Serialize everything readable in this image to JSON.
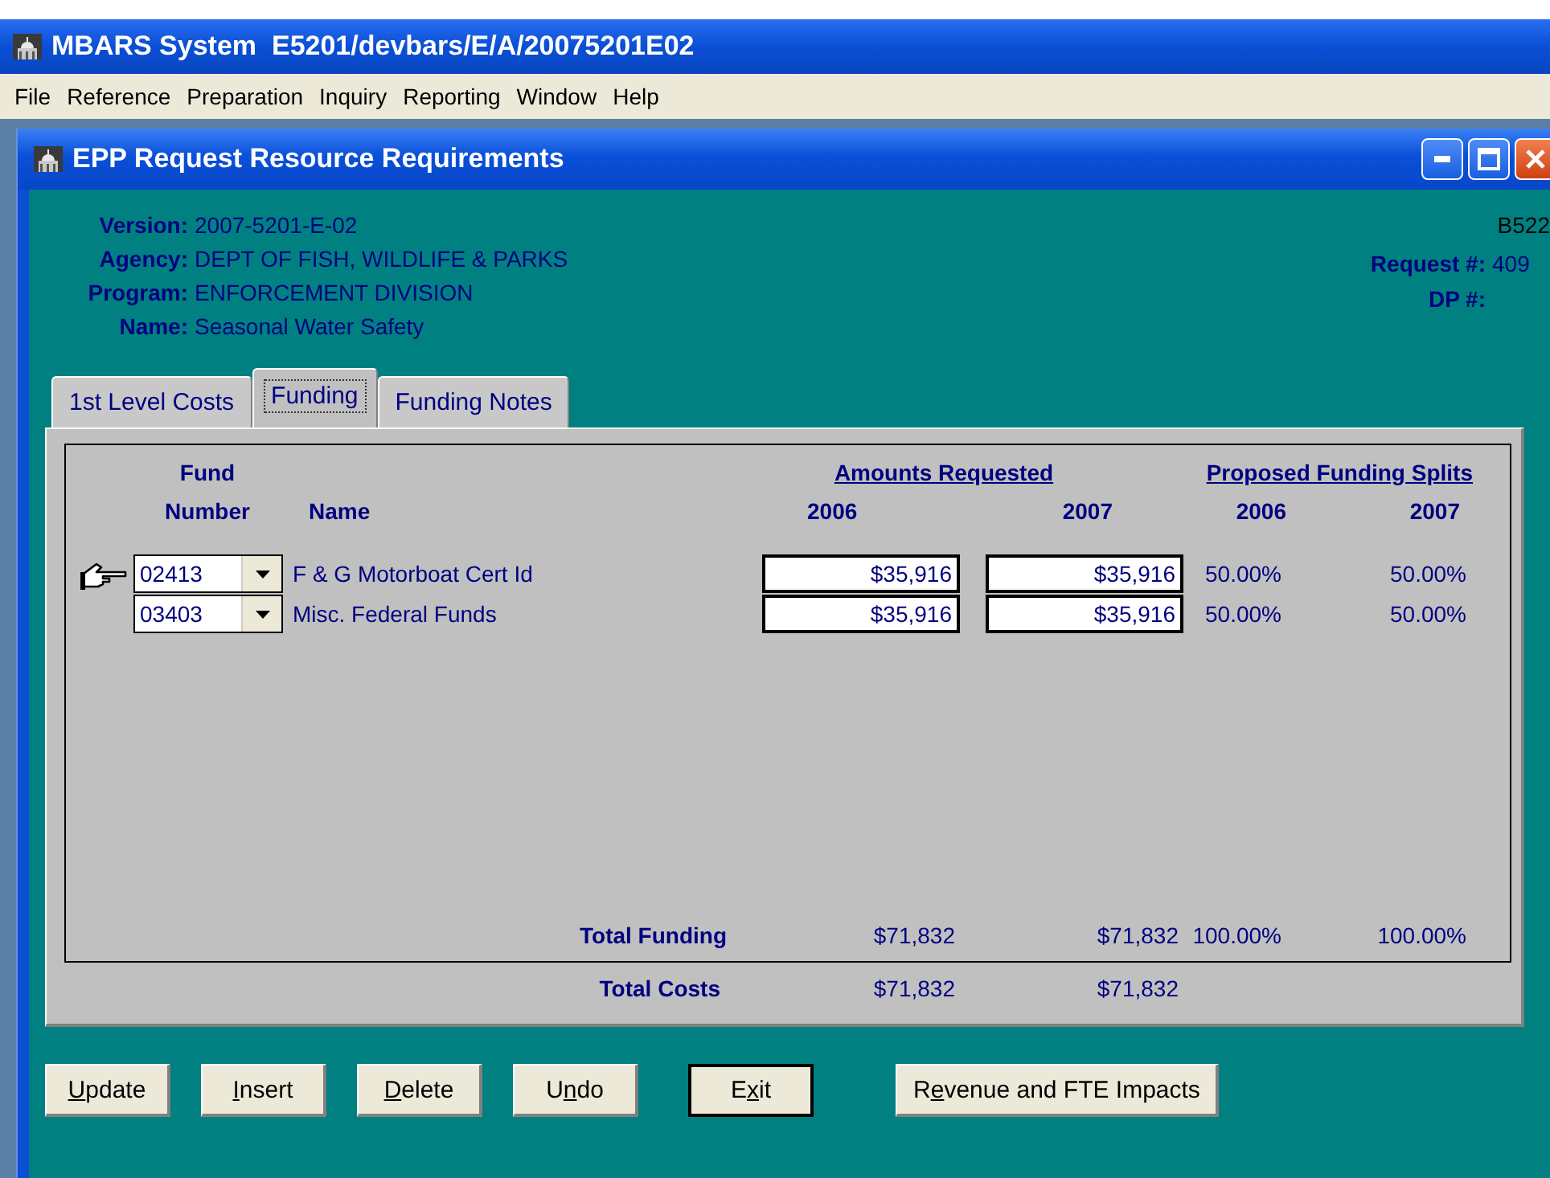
{
  "app_window": {
    "title": "MBARS System  E5201/devbars/E/A/20075201E02"
  },
  "menu": [
    "File",
    "Reference",
    "Preparation",
    "Inquiry",
    "Reporting",
    "Window",
    "Help"
  ],
  "child_window": {
    "title": "EPP Request Resource Requirements"
  },
  "header": {
    "code": "B522",
    "fields": [
      {
        "label": "Version:",
        "value": "2007-5201-E-02"
      },
      {
        "label": "Agency:",
        "value": "DEPT OF FISH, WILDLIFE & PARKS"
      },
      {
        "label": "Program:",
        "value": "ENFORCEMENT DIVISION"
      },
      {
        "label": "Name:",
        "value": "Seasonal Water Safety"
      }
    ],
    "request": {
      "label": "Request #:",
      "value": "409"
    },
    "dp": {
      "label": "DP #:"
    }
  },
  "tabs": [
    {
      "label": "1st Level Costs",
      "selected": false
    },
    {
      "label": "Funding",
      "selected": true
    },
    {
      "label": "Funding Notes",
      "selected": false
    }
  ],
  "table": {
    "group_headers": [
      "Fund",
      "Amounts Requested",
      "Proposed Funding Splits"
    ],
    "columns": [
      "Number",
      "Name",
      "2006",
      "2007",
      "2006",
      "2007"
    ],
    "rows": [
      {
        "current": true,
        "fund_number": "02413",
        "name": "F & G Motorboat Cert Id",
        "amount_2006": "$35,916",
        "amount_2007": "$35,916",
        "split_2006": "50.00%",
        "split_2007": "50.00%"
      },
      {
        "current": false,
        "fund_number": "03403",
        "name": "Misc. Federal Funds",
        "amount_2006": "$35,916",
        "amount_2007": "$35,916",
        "split_2006": "50.00%",
        "split_2007": "50.00%"
      }
    ],
    "total_funding": {
      "label": "Total Funding",
      "amount_2006": "$71,832",
      "amount_2007": "$71,832",
      "split_2006": "100.00%",
      "split_2007": "100.00%"
    }
  },
  "total_costs": {
    "label": "Total Costs",
    "amount_2006": "$71,832",
    "amount_2007": "$71,832"
  },
  "buttons": [
    {
      "key": "U",
      "after": "pdate",
      "default": false
    },
    {
      "key": "I",
      "after": "nsert",
      "default": false
    },
    {
      "key": "D",
      "after": "elete",
      "default": false
    },
    {
      "before": "U",
      "key": "n",
      "after": "do",
      "default": false
    },
    {
      "before": "E",
      "key": "x",
      "after": "it",
      "default": true
    },
    {
      "before": "R",
      "key": "e",
      "after": "venue and FTE Impacts",
      "default": false
    }
  ]
}
